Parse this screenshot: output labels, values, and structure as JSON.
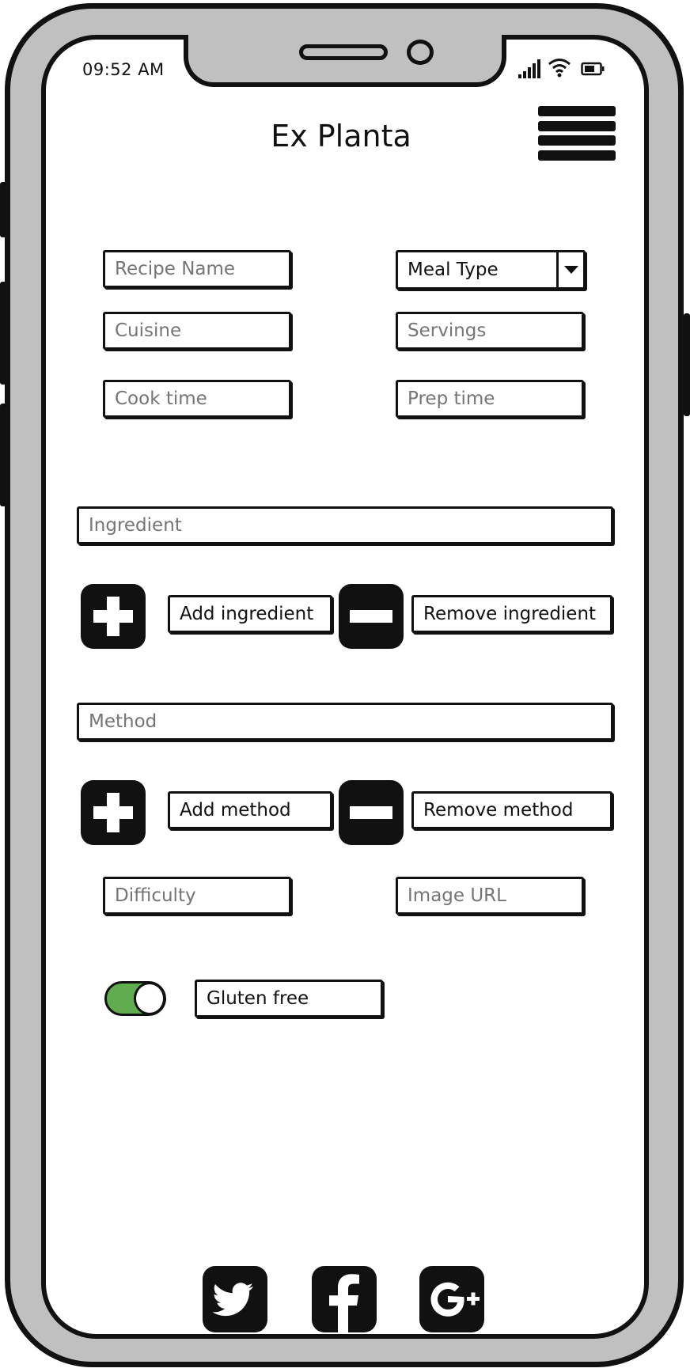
{
  "status_bar": {
    "time": "09:52 AM",
    "icons": [
      "signal-icon",
      "wifi-icon",
      "battery-icon"
    ]
  },
  "header": {
    "title": "Ex Planta",
    "menu_icon": "hamburger-menu-icon"
  },
  "form": {
    "recipe_name": {
      "placeholder": "Recipe Name"
    },
    "meal_type": {
      "selected": "Meal Type",
      "icon": "chevron-down-icon"
    },
    "cuisine": {
      "placeholder": "Cuisine"
    },
    "servings": {
      "placeholder": "Servings"
    },
    "cook_time": {
      "placeholder": "Cook time"
    },
    "prep_time": {
      "placeholder": "Prep time"
    },
    "ingredient": {
      "placeholder": "Ingredient"
    },
    "add_ingredient": {
      "label": "Add ingredient",
      "icon": "plus-icon"
    },
    "remove_ingredient": {
      "label": "Remove ingredient",
      "icon": "minus-icon"
    },
    "method": {
      "placeholder": "Method"
    },
    "add_method": {
      "label": "Add method",
      "icon": "plus-icon"
    },
    "remove_method": {
      "label": "Remove method",
      "icon": "minus-icon"
    },
    "difficulty": {
      "placeholder": "Difficulty"
    },
    "image_url": {
      "placeholder": "Image URL"
    },
    "gluten_free": {
      "label": "Gluten free",
      "toggle_on": true
    }
  },
  "footer": {
    "social": [
      "twitter-icon",
      "facebook-icon",
      "google-plus-icon"
    ]
  },
  "colors": {
    "frame": "#c0c0c0",
    "ink": "#111111",
    "toggle_on": "#62ac50",
    "screen": "#ffffff"
  }
}
